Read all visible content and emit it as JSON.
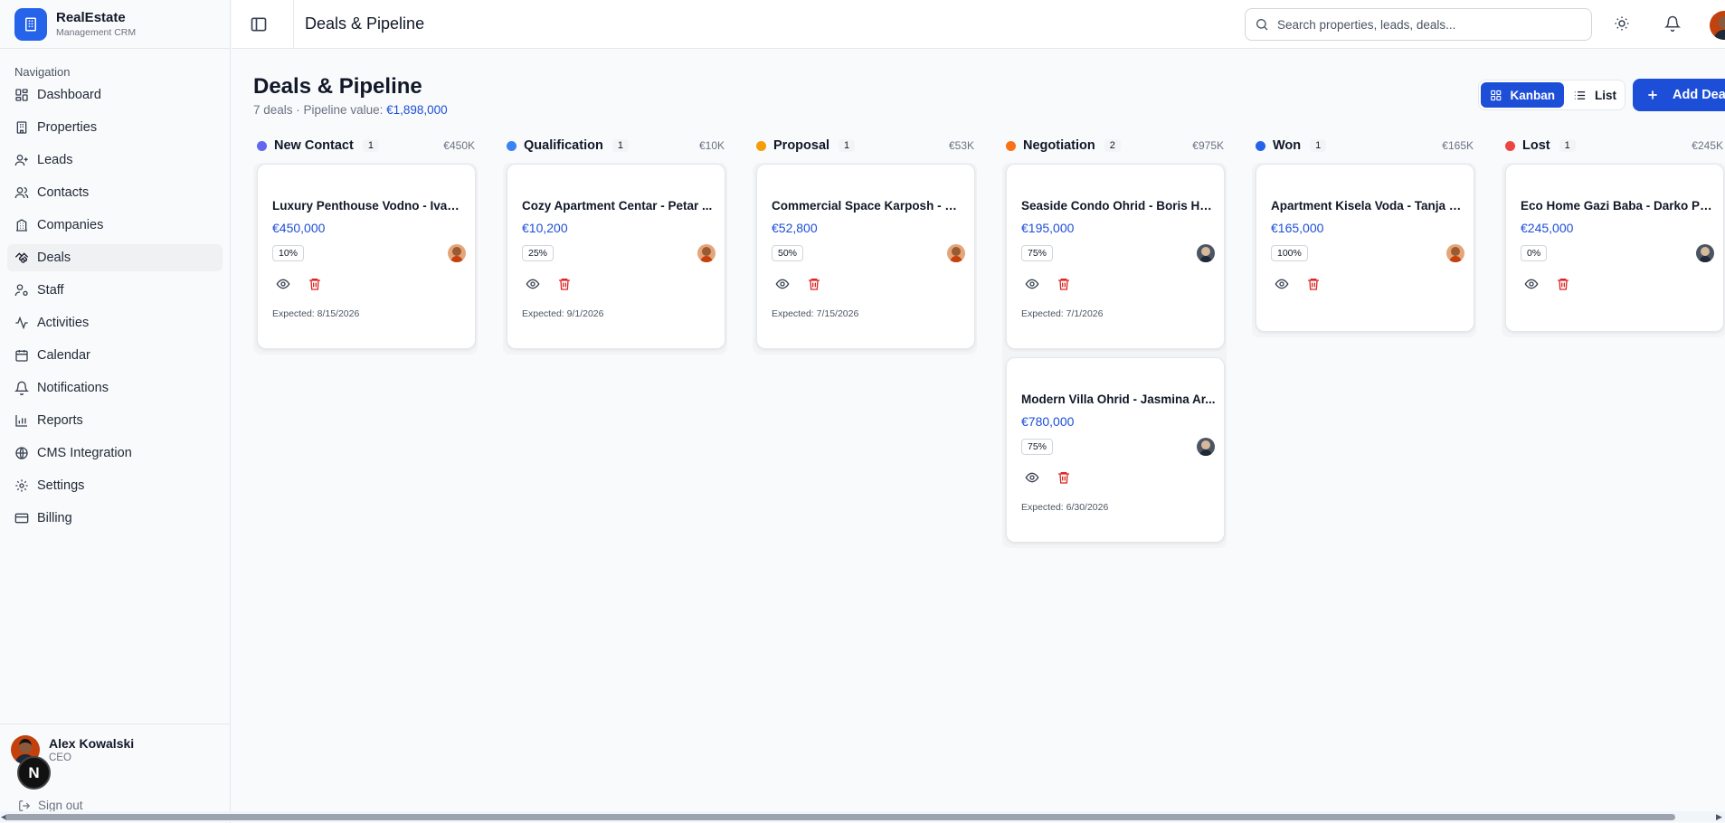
{
  "brand": {
    "name": "RealEstate",
    "subtitle": "Management CRM"
  },
  "sidebar": {
    "heading": "Navigation",
    "items": [
      {
        "label": "Dashboard",
        "icon": "dashboard-icon"
      },
      {
        "label": "Properties",
        "icon": "building-icon"
      },
      {
        "label": "Leads",
        "icon": "user-plus-icon"
      },
      {
        "label": "Contacts",
        "icon": "users-icon"
      },
      {
        "label": "Companies",
        "icon": "office-building-icon"
      },
      {
        "label": "Deals",
        "icon": "handshake-icon",
        "active": true
      },
      {
        "label": "Staff",
        "icon": "user-cog-icon"
      },
      {
        "label": "Activities",
        "icon": "activity-icon"
      },
      {
        "label": "Calendar",
        "icon": "calendar-icon"
      },
      {
        "label": "Notifications",
        "icon": "bell-icon"
      },
      {
        "label": "Reports",
        "icon": "bar-chart-icon"
      },
      {
        "label": "CMS Integration",
        "icon": "globe-icon"
      },
      {
        "label": "Settings",
        "icon": "gear-icon"
      },
      {
        "label": "Billing",
        "icon": "credit-card-icon"
      }
    ],
    "user": {
      "name": "Alex Kowalski",
      "role": "CEO"
    },
    "signout_label": "Sign out",
    "n_badge": "N"
  },
  "topbar": {
    "title": "Deals & Pipeline",
    "search_placeholder": "Search properties, leads, deals..."
  },
  "page": {
    "title": "Deals & Pipeline",
    "subtitle_prefix": "7 deals · Pipeline value: ",
    "subtitle_value": "€1,898,000",
    "view_kanban": "Kanban",
    "view_list": "List",
    "add_label": "Add Deal"
  },
  "colors": {
    "accent": "#1d4ed8",
    "danger": "#dc2626"
  },
  "columns": [
    {
      "title": "New Contact",
      "count": "1",
      "total": "€450K",
      "color": "#6366f1",
      "cards": [
        {
          "title": "Luxury Penthouse Vodno - Ivan ...",
          "amount": "€450,000",
          "prob": "10%",
          "expected": "Expected: 8/15/2026",
          "avatar": "a"
        }
      ]
    },
    {
      "title": "Qualification",
      "count": "1",
      "total": "€10K",
      "color": "#3b82f6",
      "cards": [
        {
          "title": "Cozy Apartment Centar - Petar ...",
          "amount": "€10,200",
          "prob": "25%",
          "expected": "Expected: 9/1/2026",
          "avatar": "a"
        }
      ]
    },
    {
      "title": "Proposal",
      "count": "1",
      "total": "€53K",
      "color": "#f59e0b",
      "cards": [
        {
          "title": "Commercial Space Karposh - Ma...",
          "amount": "€52,800",
          "prob": "50%",
          "expected": "Expected: 7/15/2026",
          "avatar": "a"
        }
      ]
    },
    {
      "title": "Negotiation",
      "count": "2",
      "total": "€975K",
      "color": "#f97316",
      "cards": [
        {
          "title": "Seaside Condo Ohrid - Boris Hri...",
          "amount": "€195,000",
          "prob": "75%",
          "expected": "Expected: 7/1/2026",
          "avatar": "b"
        },
        {
          "title": "Modern Villa Ohrid - Jasmina Ar...",
          "amount": "€780,000",
          "prob": "75%",
          "expected": "Expected: 6/30/2026",
          "avatar": "b"
        }
      ]
    },
    {
      "title": "Won",
      "count": "1",
      "total": "€165K",
      "color": "#2563eb",
      "cards": [
        {
          "title": "Apartment Kisela Voda - Tanja N...",
          "amount": "€165,000",
          "prob": "100%",
          "expected": "",
          "avatar": "a"
        }
      ]
    },
    {
      "title": "Lost",
      "count": "1",
      "total": "€245K",
      "color": "#ef4444",
      "cards": [
        {
          "title": "Eco Home Gazi Baba - Darko Pet...",
          "amount": "€245,000",
          "prob": "0%",
          "expected": "",
          "avatar": "b"
        }
      ]
    }
  ]
}
